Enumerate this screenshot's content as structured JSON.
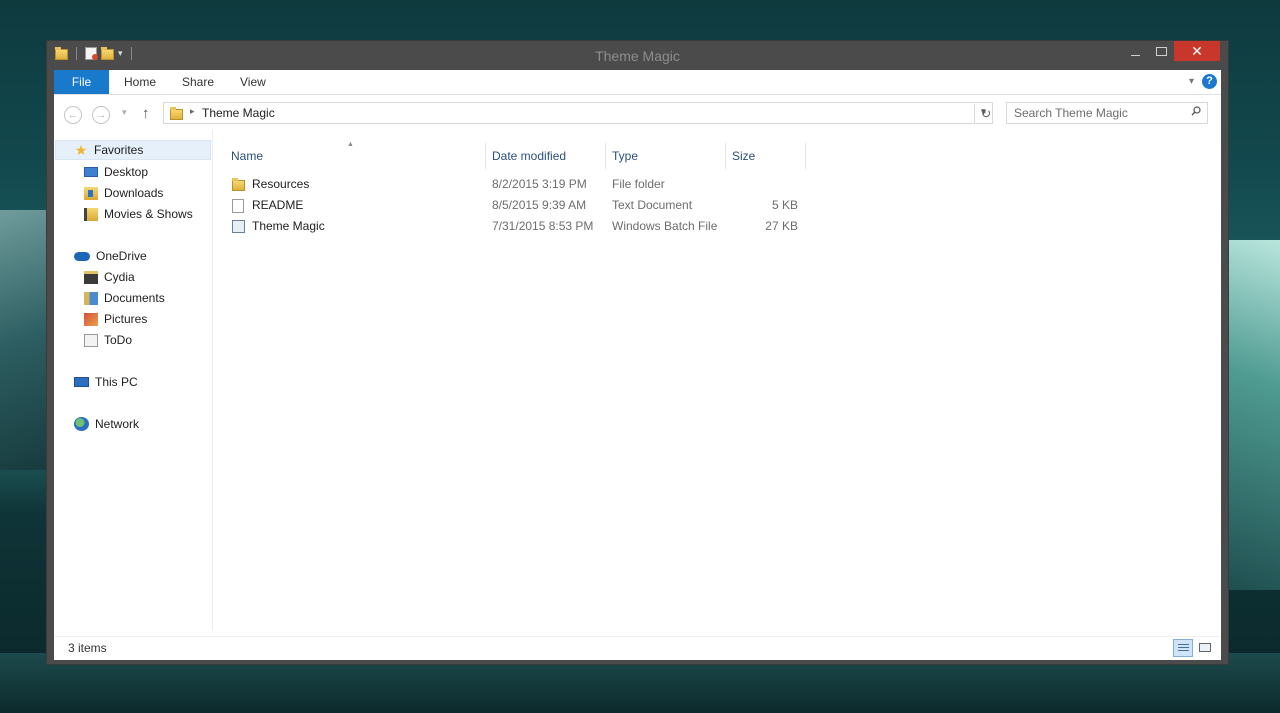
{
  "window": {
    "title": "Theme Magic"
  },
  "ribbon": {
    "tabs": [
      {
        "label": "File"
      },
      {
        "label": "Home"
      },
      {
        "label": "Share"
      },
      {
        "label": "View"
      }
    ]
  },
  "address_bar": {
    "path": "Theme Magic"
  },
  "search": {
    "placeholder": "Search Theme Magic"
  },
  "sidebar": {
    "favorites": {
      "label": "Favorites",
      "items": [
        {
          "label": "Desktop",
          "icon": "desktop-icon"
        },
        {
          "label": "Downloads",
          "icon": "downloads-icon"
        },
        {
          "label": "Movies & Shows",
          "icon": "movies-folder-icon"
        }
      ]
    },
    "onedrive": {
      "label": "OneDrive",
      "items": [
        {
          "label": "Cydia",
          "icon": "folder-icon"
        },
        {
          "label": "Documents",
          "icon": "documents-icon"
        },
        {
          "label": "Pictures",
          "icon": "pictures-icon"
        },
        {
          "label": "ToDo",
          "icon": "folder-icon"
        }
      ]
    },
    "this_pc": {
      "label": "This PC"
    },
    "network": {
      "label": "Network"
    }
  },
  "file_list": {
    "columns": [
      "Name",
      "Date modified",
      "Type",
      "Size"
    ],
    "rows": [
      {
        "name": "Resources",
        "date": "8/2/2015 3:19 PM",
        "type": "File folder",
        "size": ""
      },
      {
        "name": "README",
        "date": "8/5/2015 9:39 AM",
        "type": "Text Document",
        "size": "5 KB"
      },
      {
        "name": "Theme Magic",
        "date": "7/31/2015 8:53 PM",
        "type": "Windows Batch File",
        "size": "27 KB"
      }
    ]
  },
  "status_bar": {
    "item_count": "3 items"
  },
  "colors": {
    "accent": "#1979ca",
    "close_button": "#c7372b",
    "title_text": "#8d8d8d"
  }
}
